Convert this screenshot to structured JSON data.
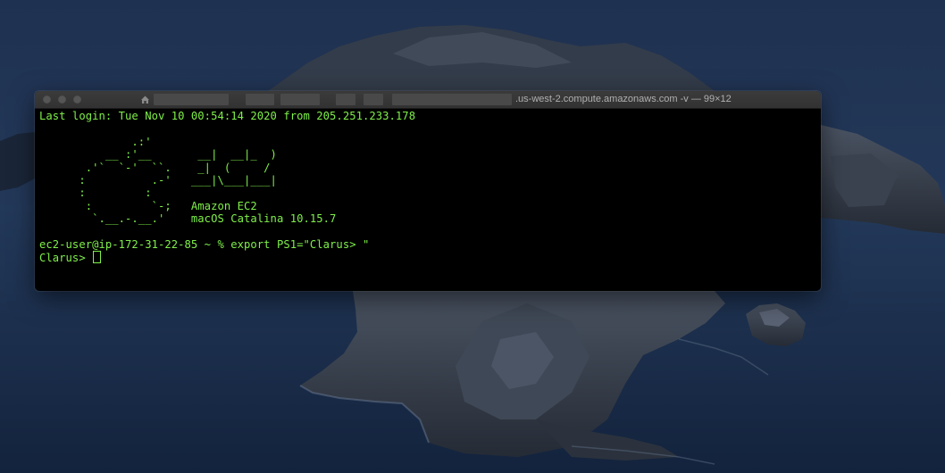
{
  "window": {
    "title": ".us-west-2.compute.amazonaws.com -v — 99×12"
  },
  "terminal": {
    "lines": [
      "Last login: Tue Nov 10 00:54:14 2020 from 205.251.233.178",
      "",
      "              .:'",
      "          __ :'__       __|  __|_  )",
      "       .'`  `-'  ``.    _|  (     /",
      "      :          .-'   ___|\\___|___|",
      "      :         :",
      "       :         `-;   Amazon EC2",
      "        `.__.-.__.'    macOS Catalina 10.15.7",
      "",
      "ec2-user@ip-172-31-22-85 ~ % export PS1=\"Clarus> \""
    ],
    "prompt": "Clarus> "
  },
  "colors": {
    "terminal_text": "#7ff04a",
    "terminal_bg": "#000000",
    "titlebar": "#353535"
  }
}
